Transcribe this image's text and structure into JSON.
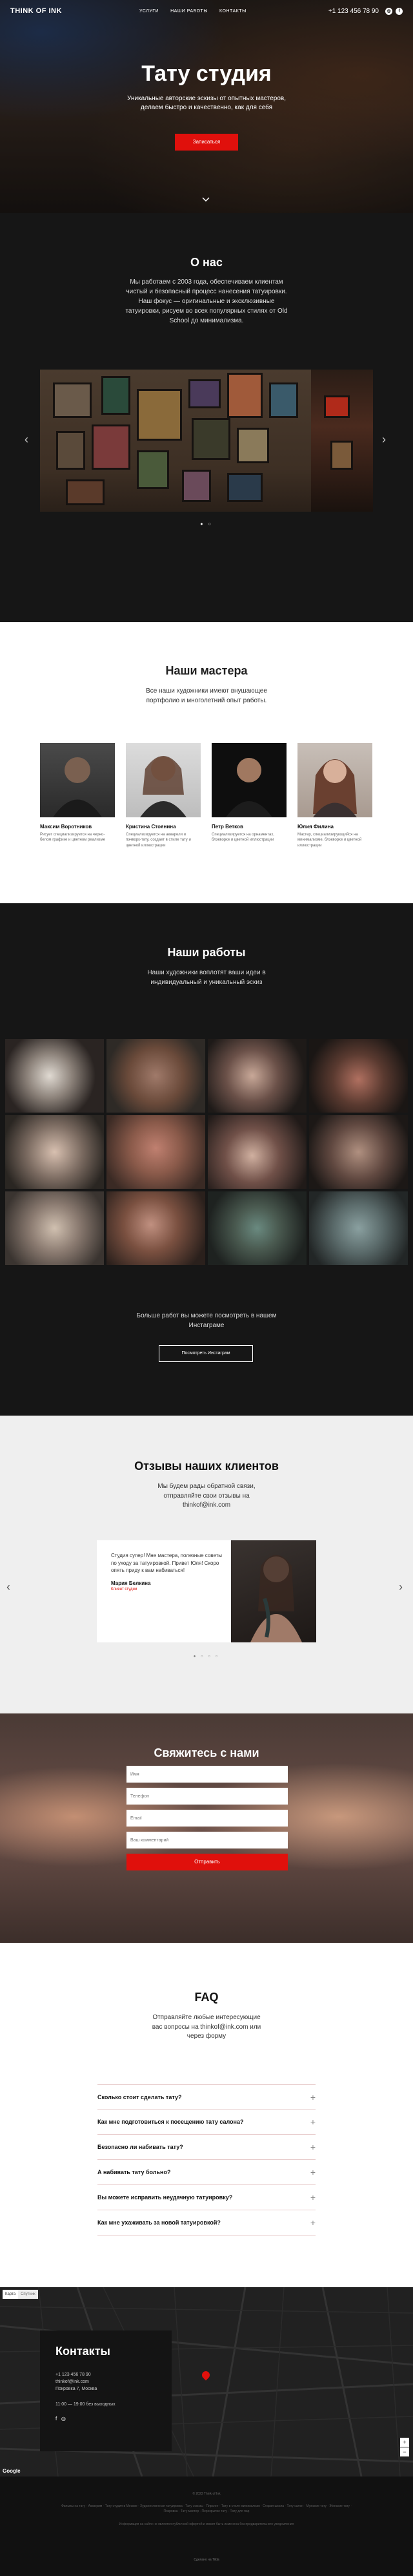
{
  "header": {
    "logo": "THINK OF INK",
    "nav": [
      "Услуги",
      "Наши работы",
      "Контакты"
    ],
    "phone": "+1 123 456 78 90",
    "social_icons": [
      "instagram-icon",
      "facebook-icon"
    ]
  },
  "hero": {
    "title": "Тату студия",
    "subtitle": "Уникальные авторские эскизы от опытных мастеров, делаем быстро и качественно, как для себя",
    "cta": "Записаться"
  },
  "about": {
    "title": "О нас",
    "text": "Мы работаем с 2003 года, обеспечиваем клиентам чистый и безопасный процесс нанесения татуировки. Наш фокус — оригинальные и эксклюзивные татуировки, рисуем во всех популярных стилях от Old School до минимализма."
  },
  "masters": {
    "title": "Наши мастера",
    "subtitle": "Все наши художники имеют внушающее портфолио и многолетний опыт работы.",
    "items": [
      {
        "name": "Максим Воротников",
        "desc": "Рисует специализируется на черно-белом графике и цветном реализме"
      },
      {
        "name": "Кристина Стоянина",
        "desc": "Специализируется на акварели и пэчворк-тату, создает в стиле тату и цветной иллюстрации"
      },
      {
        "name": "Петр Ветков",
        "desc": "Специализируется на орнаментах, блэкворке и цветной иллюстрации"
      },
      {
        "name": "Юлия Филина",
        "desc": "Мастер, специализирующийся на минимализме, блэкворке и цветной иллюстрации"
      }
    ]
  },
  "works": {
    "title": "Наши работы",
    "subtitle": "Наши художники воплотят ваши идеи в индивидуальный и уникальный эскиз",
    "more_text": "Больше работ вы можете посмотреть в нашем Инстаграме",
    "button": "Посмотреть Инстаграм"
  },
  "reviews": {
    "title": "Отзывы наших клиентов",
    "subtitle": "Мы будем рады обратной связи, отправляйте свои отзывы на thinkof@ink.com",
    "text": "Студия супер! Мне мастера, полезные советы по уходу за татуировкой. Привет Юля! Скоро опять приду к вам набиваться!",
    "name": "Мария Белкина",
    "role": "Клиент студии"
  },
  "contact": {
    "title": "Свяжитесь с нами",
    "placeholders": [
      "Имя",
      "Телефон",
      "Email",
      "Ваш комментарий"
    ],
    "button": "Отправить"
  },
  "faq": {
    "title": "FAQ",
    "subtitle": "Отправляйте любые интересующие вас вопросы на thinkof@ink.com или через форму",
    "questions": [
      "Сколько стоит сделать тату?",
      "Как мне подготовиться к посещению тату салона?",
      "Безопасно ли набивать тату?",
      "А набивать тату больно?",
      "Вы можете исправить неудачную татуировку?",
      "Как мне ухаживать за новой татуировкой?"
    ]
  },
  "map": {
    "buttons": [
      "Карта",
      "Спутник"
    ],
    "card_title": "Контакты",
    "lines": [
      "+1 123 456 78 90",
      "thinkof@ink.com",
      "Покровка 7, Москва",
      "11:00 — 19:00 без выходных"
    ],
    "google": "Google"
  },
  "footer": {
    "copy": "© 2023 Think of Ink",
    "tags": "Фильмы на тату · Аквагрим · Тату студия в Москве · Художественная татуировка · Тату эскизы · Пирсинг · Тату в стиле минимализм · Старая школа · Тату салон · Мужские тату · Женские тату · Покровка · Тату мастер · Перекрытие тату · Тату для пар",
    "disclaimer": "Информация на сайте не является публичной офертой и может быть изменена без предварительного уведомления",
    "made": "Сделано на Tilda"
  }
}
